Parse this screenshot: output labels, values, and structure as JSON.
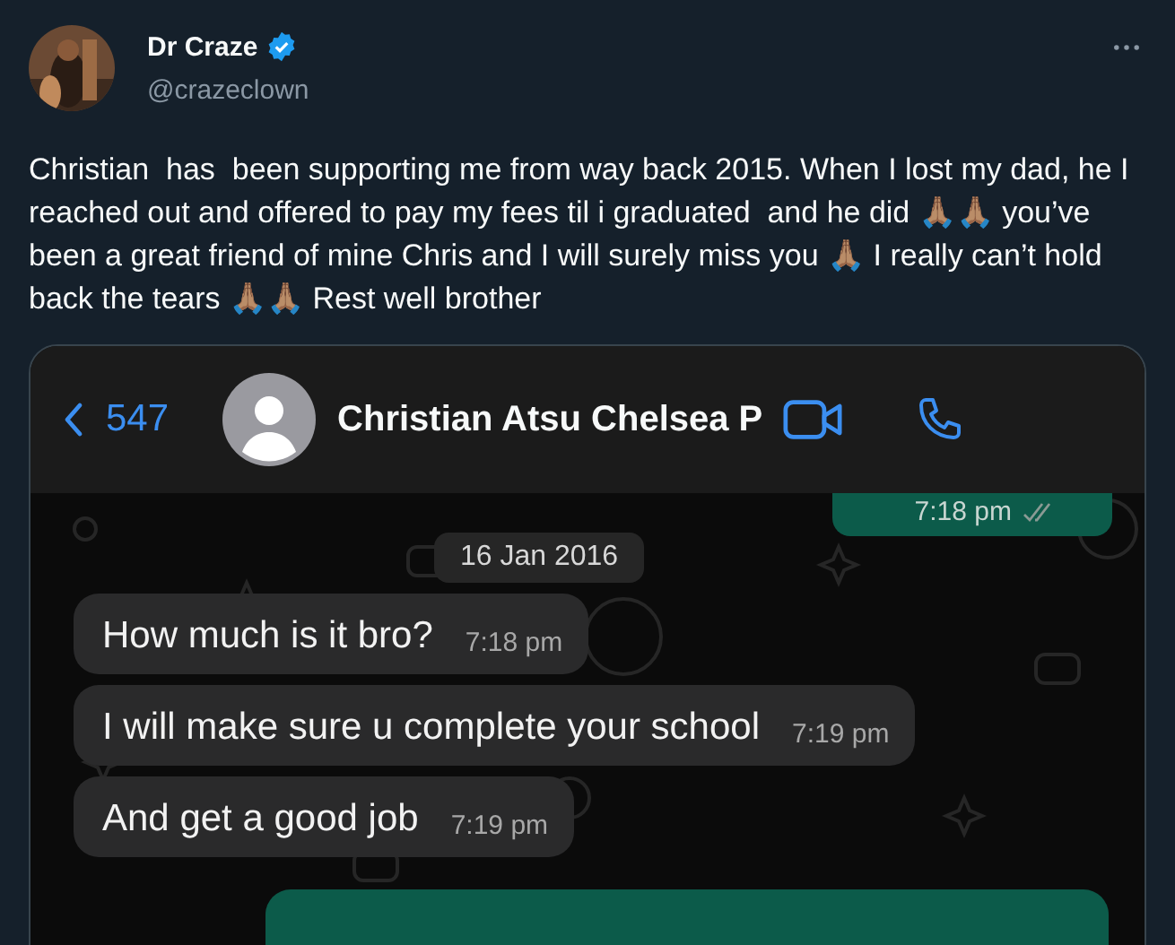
{
  "author": {
    "name": "Dr Craze",
    "verified": true,
    "handle": "@crazeclown"
  },
  "tweet_text": "Christian  has  been supporting me from way back 2015. When I lost my dad, he I reached out and offered to pay my fees til i graduated  and he did 🙏🏽🙏🏽 you’ve been a great friend of mine Chris and I will surely miss you 🙏🏽 I really can’t hold back the tears 🙏🏽🙏🏽 Rest well brother",
  "chat": {
    "back_count": "547",
    "contact_name": "Christian Atsu Chelsea P",
    "messages": [
      {
        "kind": "outgoing",
        "time": "7:18 pm",
        "read": true
      },
      {
        "kind": "date",
        "text": "16 Jan 2016"
      },
      {
        "kind": "incoming",
        "text": "How much is it bro?",
        "time": "7:18 pm"
      },
      {
        "kind": "incoming",
        "text": "I will make sure u complete your school",
        "time": "7:19 pm"
      },
      {
        "kind": "incoming",
        "text": "And get a good job",
        "time": "7:19 pm"
      },
      {
        "kind": "outgoing"
      }
    ]
  }
}
